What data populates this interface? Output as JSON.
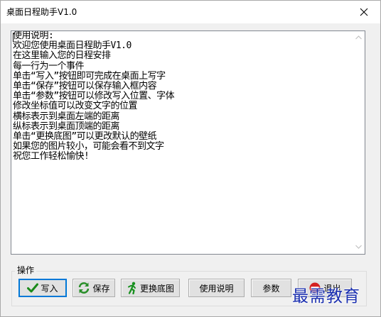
{
  "window": {
    "title": "桌面日程助手V1.0",
    "close_icon": "close-icon"
  },
  "editor": {
    "lines": [
      "使用说明:",
      "欢迎您使用桌面日程助手V1.0",
      "在这里输入您的日程安排",
      "每一行为一个事件",
      "单击“写入”按钮即可完成在桌面上写字",
      "单击“保存”按钮可以保存输入框内容",
      "单击“参数”按钮可以修改写入位置、字体",
      "修改坐标值可以改变文字的位置",
      "横标表示到桌面左端的距离",
      "纵标表示到桌面顶端的距离",
      "单击“更换底图”可以更改默认的壁纸",
      "如果您的图片较小，可能会看不到文字",
      "祝您工作轻松愉快!"
    ],
    "scroll_up_icon": "chevron-up-icon",
    "scroll_down_icon": "chevron-down-icon"
  },
  "actions": {
    "group_label": "操作",
    "write_label": "写入",
    "write_icon": "checkmark-icon",
    "save_label": "保存",
    "save_icon": "refresh-icon",
    "change_bg_label": "更换底图",
    "change_bg_icon": "running-man-icon",
    "help_label": "使用说明",
    "params_label": "参数",
    "exit_label": "退出",
    "exit_icon": "no-entry-icon"
  },
  "watermark": {
    "text": "最需教育"
  },
  "colors": {
    "accent": "#0078d7",
    "check_green": "#1a8a1a",
    "save_green": "#2a8f2a",
    "stop_red": "#d42020",
    "watermark_blue": "#1a2fb0"
  }
}
